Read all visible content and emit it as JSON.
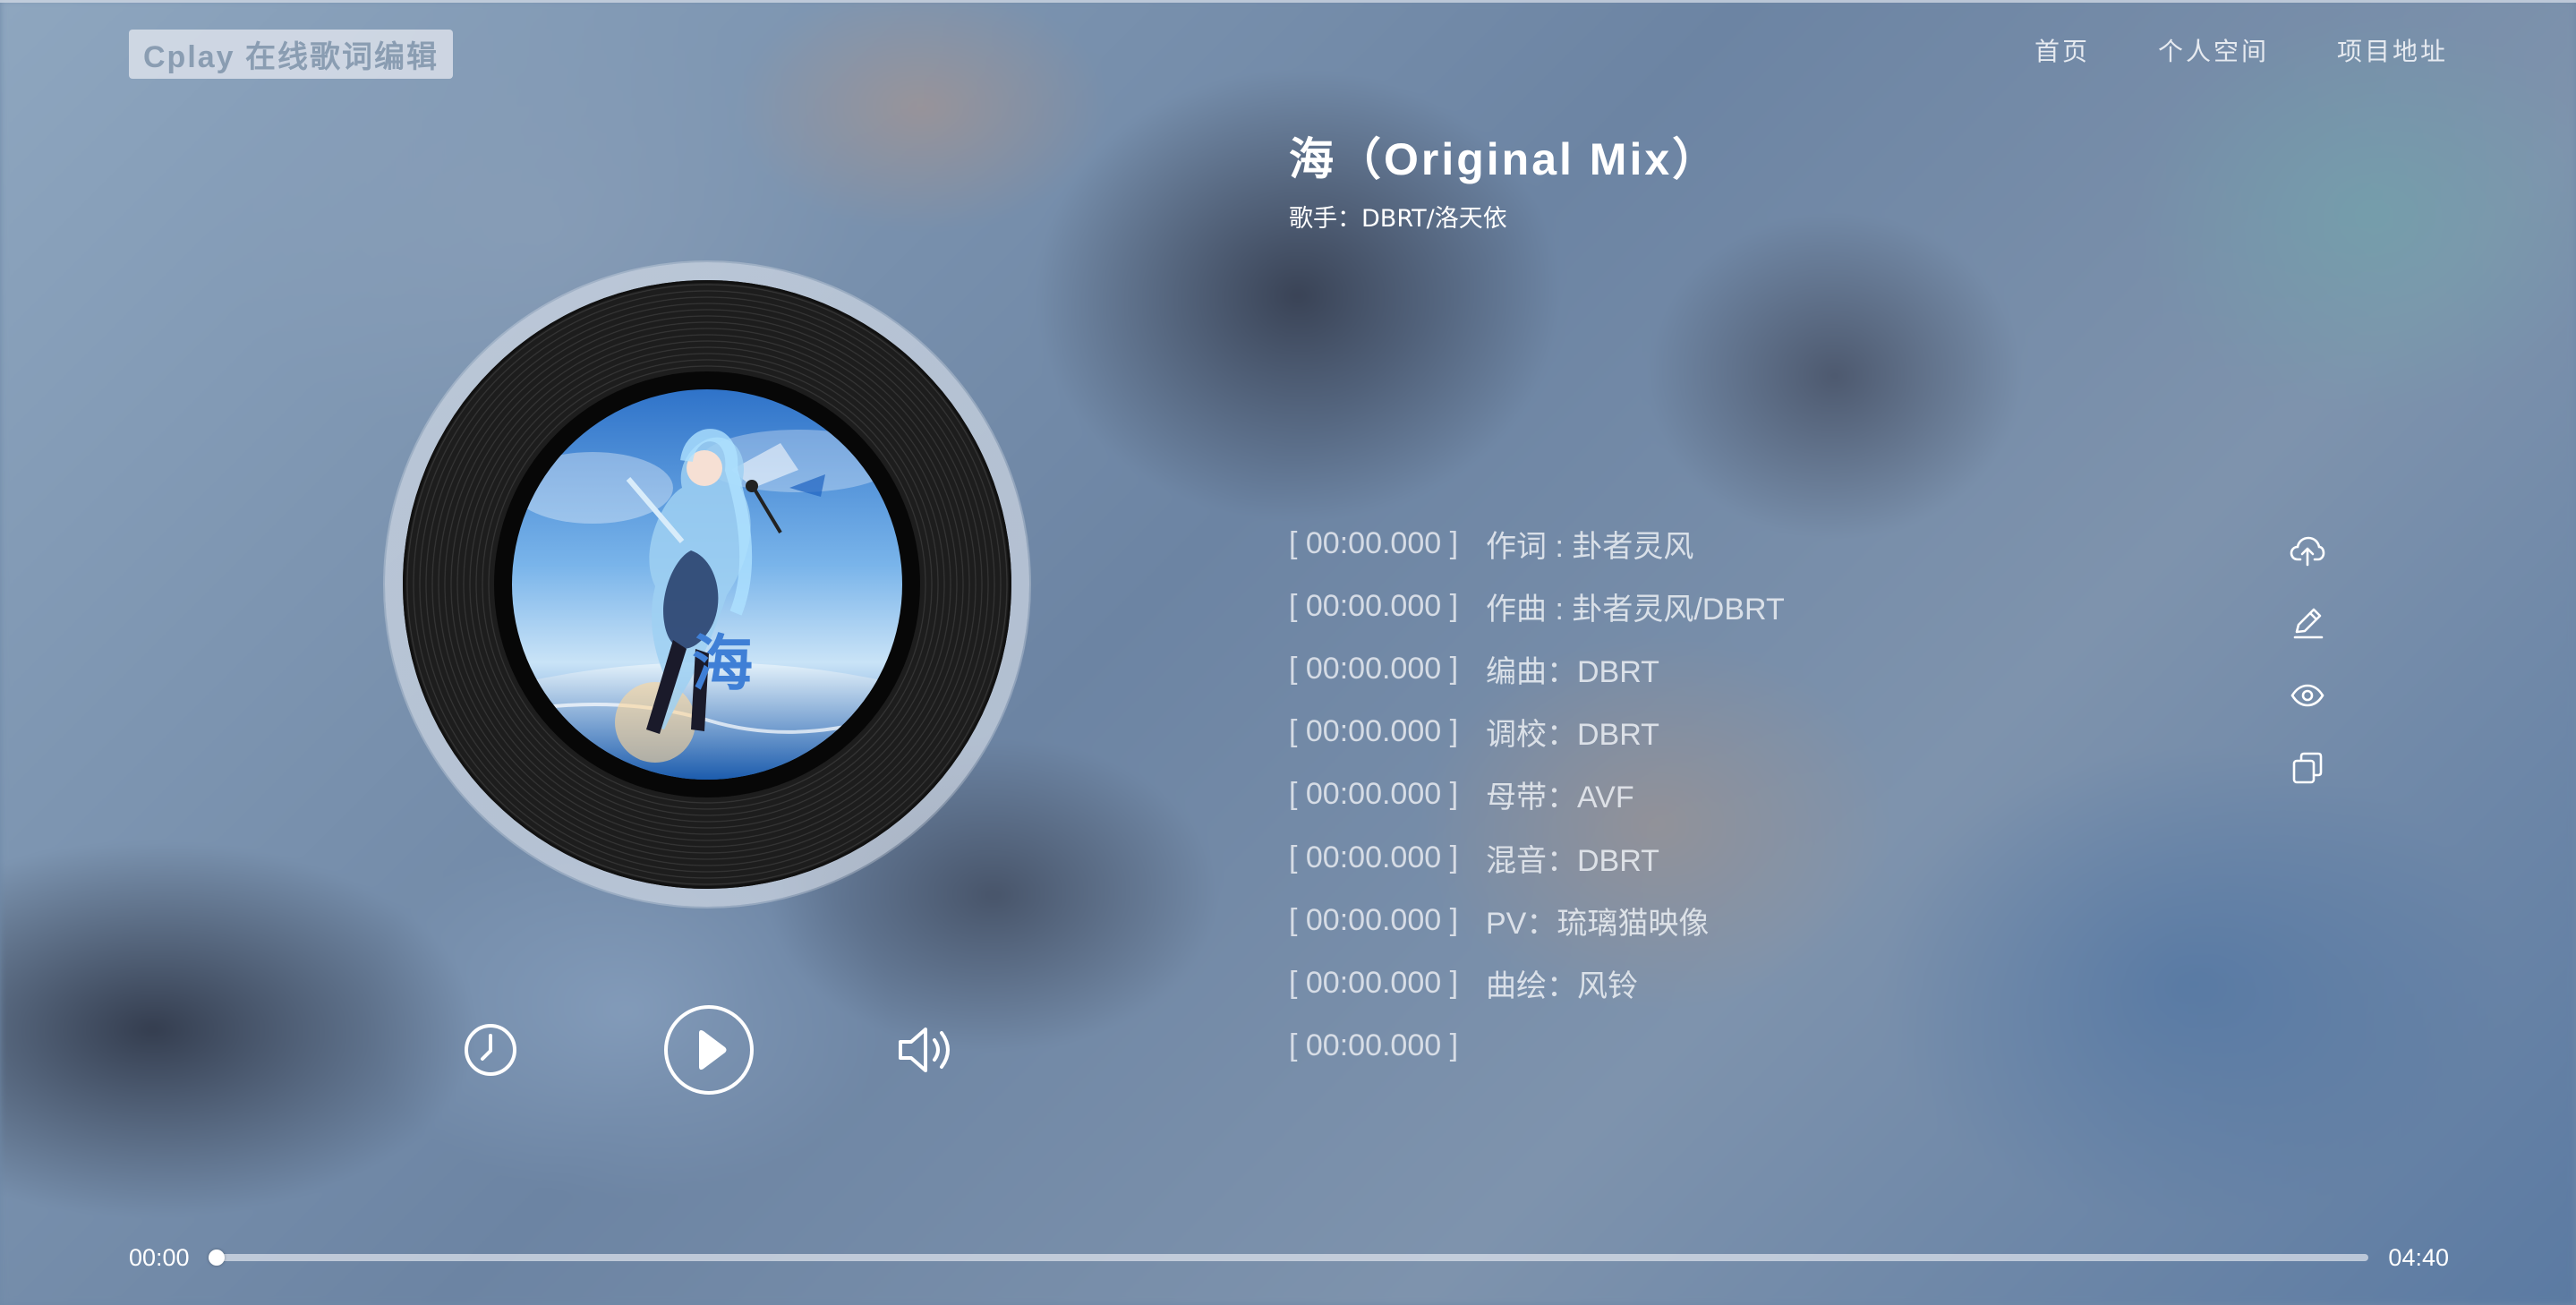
{
  "header": {
    "logo_text": "Cplay 在线歌词编辑",
    "nav": [
      {
        "label": "首页"
      },
      {
        "label": "个人空间"
      },
      {
        "label": "项目地址"
      }
    ]
  },
  "song": {
    "title": "海（Original Mix）",
    "artist_label": "歌手：",
    "artist": "DBRT/洛天依",
    "cover_text": "海"
  },
  "lyrics": [
    {
      "time": "[ 00:00.000 ]",
      "text": "作词 : 卦者灵风"
    },
    {
      "time": "[ 00:00.000 ]",
      "text": "作曲 : 卦者灵风/DBRT"
    },
    {
      "time": "[ 00:00.000 ]",
      "text": "编曲：DBRT"
    },
    {
      "time": "[ 00:00.000 ]",
      "text": "调校：DBRT"
    },
    {
      "time": "[ 00:00.000 ]",
      "text": "母带：AVF"
    },
    {
      "time": "[ 00:00.000 ]",
      "text": "混音：DBRT"
    },
    {
      "time": "[ 00:00.000 ]",
      "text": "PV：琉璃猫映像"
    },
    {
      "time": "[ 00:00.000 ]",
      "text": "曲绘：风铃"
    },
    {
      "time": "[ 00:00.000 ]",
      "text": ""
    }
  ],
  "player": {
    "controls": [
      "clock-icon",
      "play-icon",
      "volume-icon"
    ],
    "current_time": "00:00",
    "total_time": "04:40",
    "progress": 0
  },
  "tools": [
    "upload-cloud-icon",
    "edit-pencil-icon",
    "preview-eye-icon",
    "copy-icon"
  ],
  "colors": {
    "accent": "#ffffff",
    "logo_bg": "#e1e6ee",
    "logo_text": "#8a9db2"
  }
}
